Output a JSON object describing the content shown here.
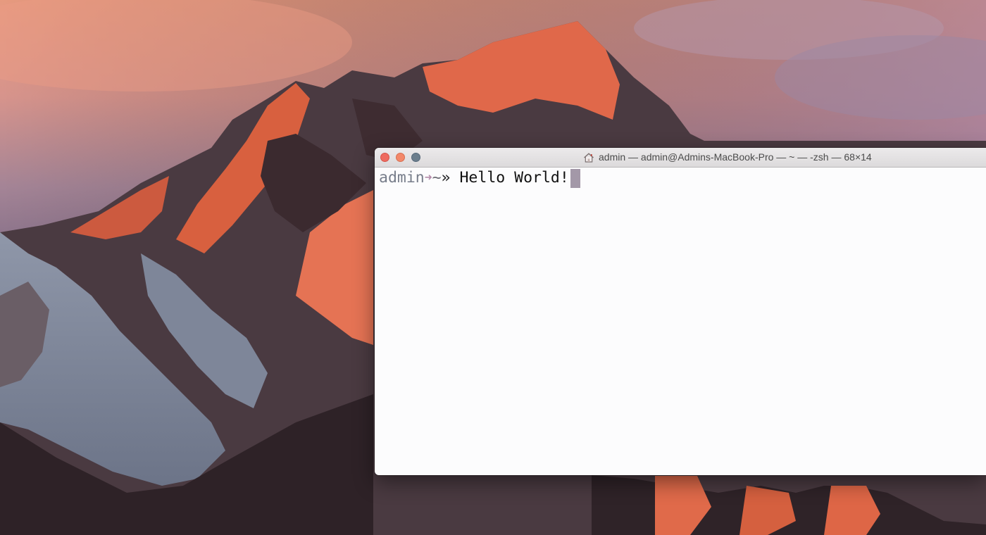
{
  "window": {
    "title": "admin — admin@Admins-MacBook-Pro — ~ — -zsh — 68×14",
    "title_icon": "home-icon",
    "controls": {
      "close": "close-icon",
      "minimize": "minimize-icon",
      "zoom": "zoom-icon"
    }
  },
  "terminal": {
    "prompt": {
      "user": "admin",
      "arrow": "➜",
      "path": "~",
      "chevron": "»"
    },
    "command": "Hello World!"
  },
  "colors": {
    "close": "#ee6b60",
    "minimize": "#f3886a",
    "zoom": "#6b7e8d",
    "cursor": "#a398a8",
    "prompt_user": "#777d8a",
    "prompt_arrow": "#b48aa9"
  }
}
